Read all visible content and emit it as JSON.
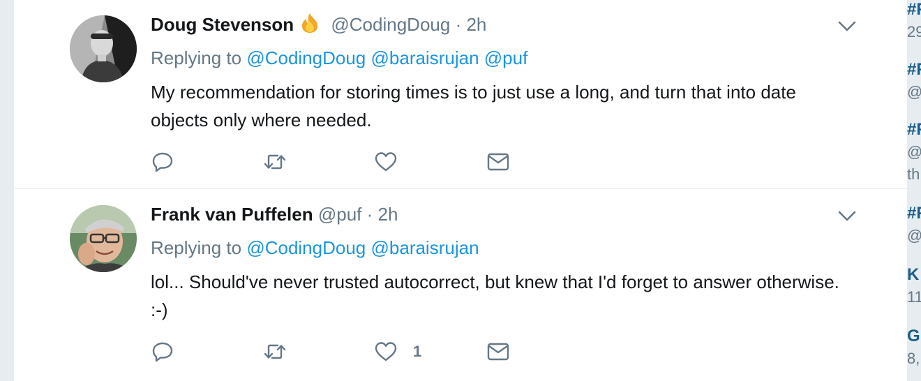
{
  "tweets": [
    {
      "name": "Doug Stevenson",
      "handle": "@CodingDoug",
      "separator": "·",
      "time": "2h",
      "replying_prefix": "Replying to",
      "mentions": [
        "@CodingDoug",
        "@baraisrujan",
        "@puf"
      ],
      "text": "My recommendation for storing times is to just use a long, and turn that into date objects only where needed.",
      "like_count": ""
    },
    {
      "name": "Frank van Puffelen",
      "handle": "@puf",
      "separator": "·",
      "time": "2h",
      "replying_prefix": "Replying to",
      "mentions": [
        "@CodingDoug",
        "@baraisrujan"
      ],
      "text": "lol... Should've never trusted autocorrect, but knew that I'd forget to answer otherwise. :-)",
      "like_count": "1"
    }
  ],
  "sidebar": {
    "items": [
      {
        "title": "#F",
        "sub": "29"
      },
      {
        "title": "#F",
        "sub": "@"
      },
      {
        "title": "#F",
        "sub": "@",
        "extra": "th"
      },
      {
        "title": "#F",
        "sub": "@"
      },
      {
        "title": "K",
        "sub": "11"
      },
      {
        "title": "G",
        "sub": "8,"
      }
    ]
  },
  "colors": {
    "link": "#1b95e0",
    "muted": "#657786",
    "text": "#14171a",
    "trend": "#1b5f8a",
    "background": "#e6ecf0"
  },
  "icons": [
    "chevron-down-icon",
    "flame-icon",
    "reply-icon",
    "retweet-icon",
    "heart-icon",
    "envelope-icon"
  ]
}
